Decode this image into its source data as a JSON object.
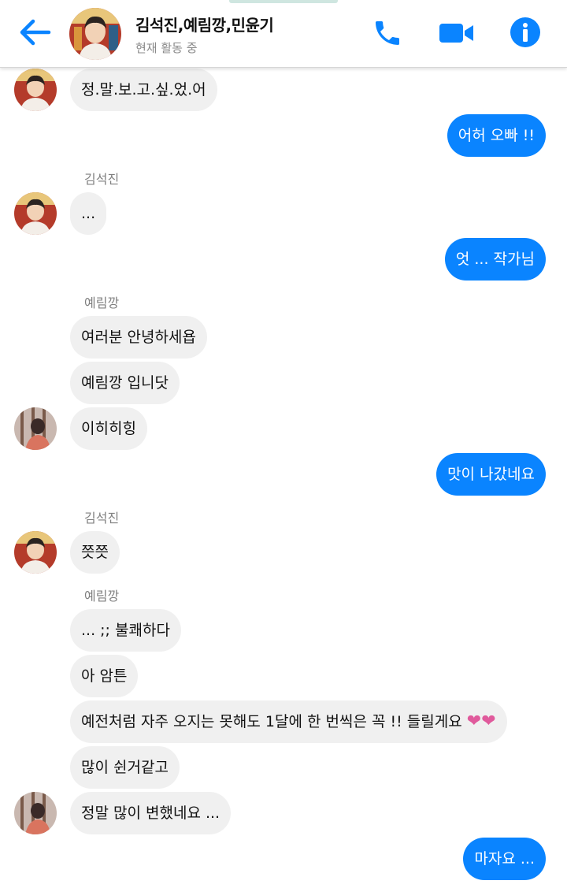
{
  "header": {
    "title": "김석진,예림깡,민윤기",
    "status": "현재 활동 중"
  },
  "colors": {
    "accent": "#0a84ff",
    "incoming_bubble": "#f0f0f0",
    "heart": "#e05a9c"
  },
  "icons": {
    "back": "back-arrow-icon",
    "call": "phone-icon",
    "video": "video-camera-icon",
    "info": "info-icon"
  },
  "messages": [
    {
      "type": "in",
      "text": "정.말.보.고.싶.었.어"
    },
    {
      "type": "out",
      "text": "어허 오빠 !!"
    },
    {
      "type": "sender",
      "text": "김석진"
    },
    {
      "type": "in",
      "text": "..."
    },
    {
      "type": "out",
      "text": "엇 ... 작가님"
    },
    {
      "type": "sender",
      "text": "예림깡"
    },
    {
      "type": "in",
      "text": "여러분 안녕하세욥"
    },
    {
      "type": "in",
      "text": "예림깡 입니닷"
    },
    {
      "type": "in",
      "text": "이히히힝"
    },
    {
      "type": "out",
      "text": "맛이 나갔네요"
    },
    {
      "type": "sender",
      "text": "김석진"
    },
    {
      "type": "in",
      "text": "쯧쯧"
    },
    {
      "type": "sender",
      "text": "예림깡"
    },
    {
      "type": "in",
      "text": "... ;; 불쾌하다"
    },
    {
      "type": "in",
      "text": "아 암튼"
    },
    {
      "type": "in",
      "text": "예전처럼 자주 오지는 못해도 1달에 한 번씩은 꼭 !! 들릴게요",
      "hearts": "❤❤"
    },
    {
      "type": "in",
      "text": "많이 쉰거같고"
    },
    {
      "type": "in",
      "text": "정말 많이 변했네요 ..."
    },
    {
      "type": "out",
      "text": "마자요 ..."
    }
  ]
}
